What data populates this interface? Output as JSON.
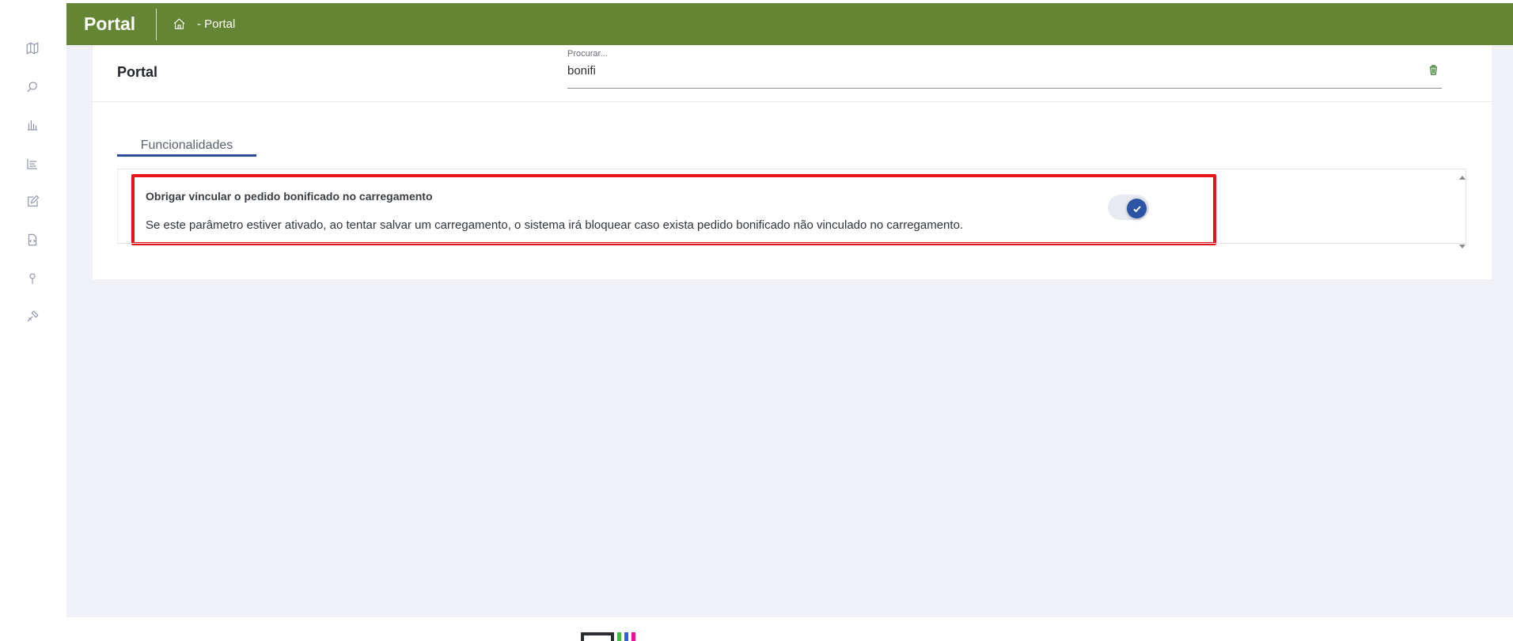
{
  "sidebar": {
    "items": [
      {
        "icon": "map-icon"
      },
      {
        "icon": "search-icon"
      },
      {
        "icon": "chart-icon"
      },
      {
        "icon": "list-icon"
      },
      {
        "icon": "edit-icon"
      },
      {
        "icon": "document-code-icon"
      },
      {
        "icon": "location-pin-icon"
      },
      {
        "icon": "tools-icon"
      }
    ]
  },
  "header": {
    "brand": "Portal",
    "home_icon": "home-icon",
    "breadcrumb": "- Portal",
    "color": "#638534"
  },
  "main": {
    "title": "Portal",
    "search": {
      "label": "Procurar...",
      "value": "bonifi",
      "clear_icon": "trash-icon"
    },
    "tabs": [
      {
        "label": "Funcionalidades",
        "active": true
      }
    ],
    "items": [
      {
        "title": "Obrigar vincular o pedido bonificado no carregamento",
        "description": "Se este parâmetro estiver ativado, ao tentar salvar um carregamento, o sistema irá bloquear caso exista pedido bonificado não vinculado no carregamento.",
        "enabled": true
      }
    ]
  },
  "colors": {
    "accent": "#2b54a6",
    "highlight": "#e8141c"
  }
}
